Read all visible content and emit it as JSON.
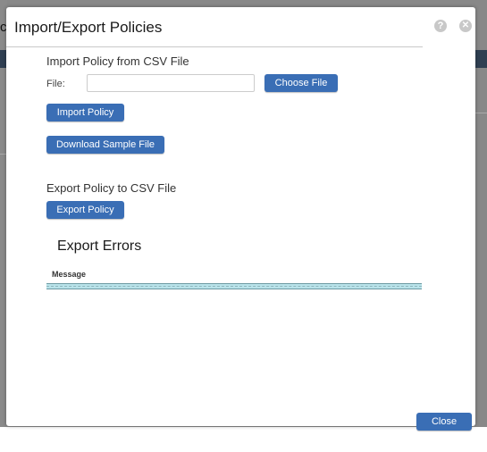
{
  "background": {
    "partial_title_text": "co"
  },
  "modal": {
    "title": "Import/Export Policies",
    "help_glyph": "?",
    "close_glyph": "✕",
    "import_section": {
      "heading": "Import Policy from CSV File",
      "file_label": "File:",
      "file_value": "",
      "choose_file_label": "Choose File",
      "import_button_label": "Import Policy",
      "download_sample_label": "Download Sample File"
    },
    "export_section": {
      "heading": "Export Policy to CSV File",
      "export_button_label": "Export Policy"
    },
    "errors": {
      "title": "Export Errors",
      "columns": [
        "Message"
      ],
      "rows": []
    },
    "footer": {
      "close_label": "Close"
    }
  },
  "colors": {
    "accent": "#3a6eb5",
    "grid_row": "#b9e3ea",
    "icon_gray": "#c8c8c8"
  },
  "icons": {
    "help": "help-icon",
    "close": "close-icon"
  }
}
